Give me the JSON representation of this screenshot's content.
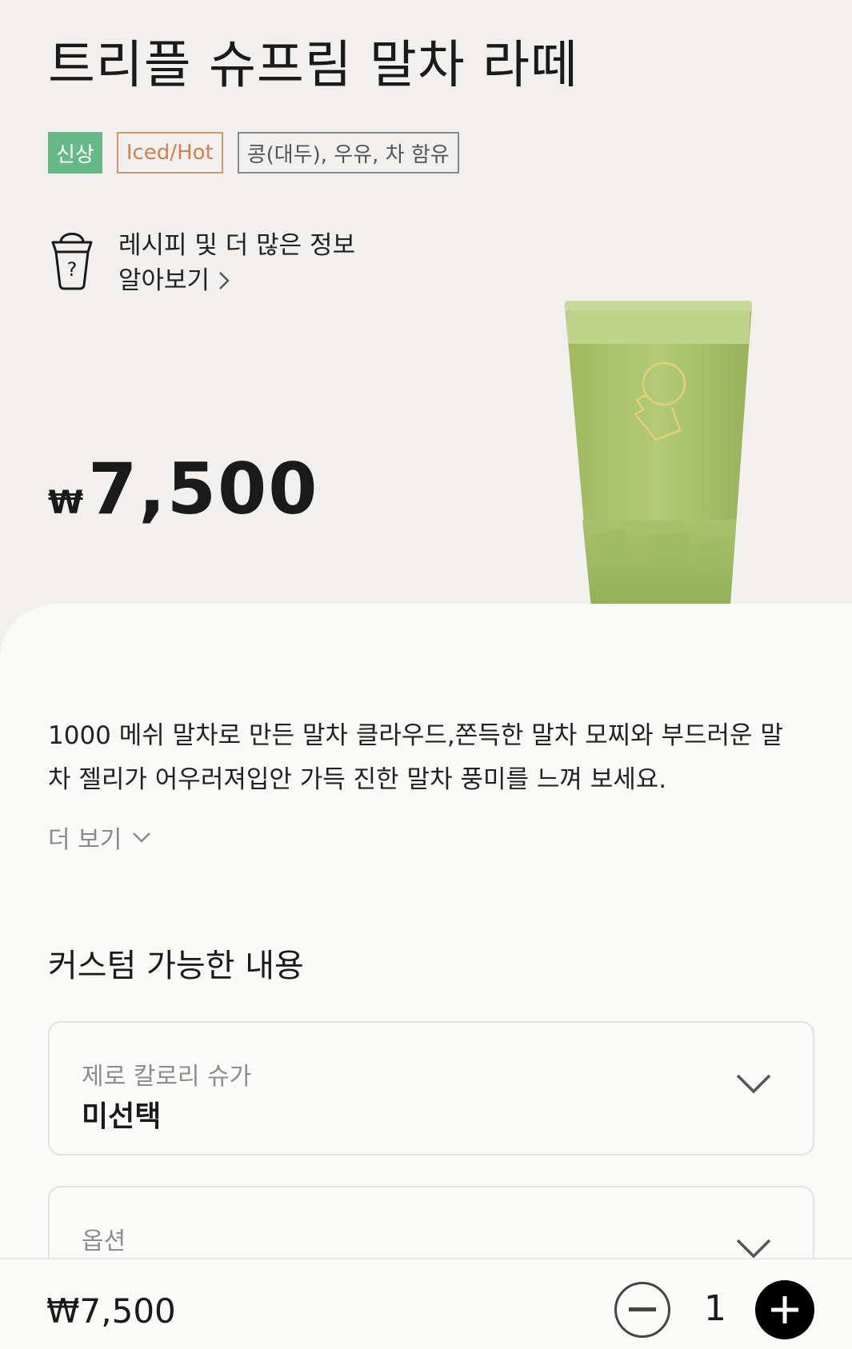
{
  "product": {
    "name": "트리플 슈프림 말차 라떼",
    "badges": {
      "new": "신상",
      "temperature": "Iced/Hot",
      "allergens": "콩(대두), 우유, 차 함유"
    },
    "recipe_link": {
      "line1": "레시피 및 더 많은 정보",
      "line2": "알아보기"
    },
    "price": {
      "currency": "₩",
      "value": "7,500"
    },
    "description": "1000 메쉬 말차로 만든 말차 클라우드,쫀득한 말차 모찌와 부드러운 말차 젤리가 어우러져입안 가득 진한 말차 풍미를 느껴 보세요.",
    "more_label": "더 보기"
  },
  "customization": {
    "title": "커스텀 가능한 내용",
    "options": [
      {
        "label": "제로 칼로리 슈가",
        "value": "미선택"
      },
      {
        "label": "옵션",
        "value": ""
      }
    ]
  },
  "bottom_bar": {
    "total_price": "₩7,500",
    "quantity": "1"
  },
  "colors": {
    "background": "#f1f0ee",
    "panel": "#f9f9f7",
    "new_badge": "#65b987",
    "temp_badge": "#d0814d",
    "matcha": "#a9c06a"
  }
}
